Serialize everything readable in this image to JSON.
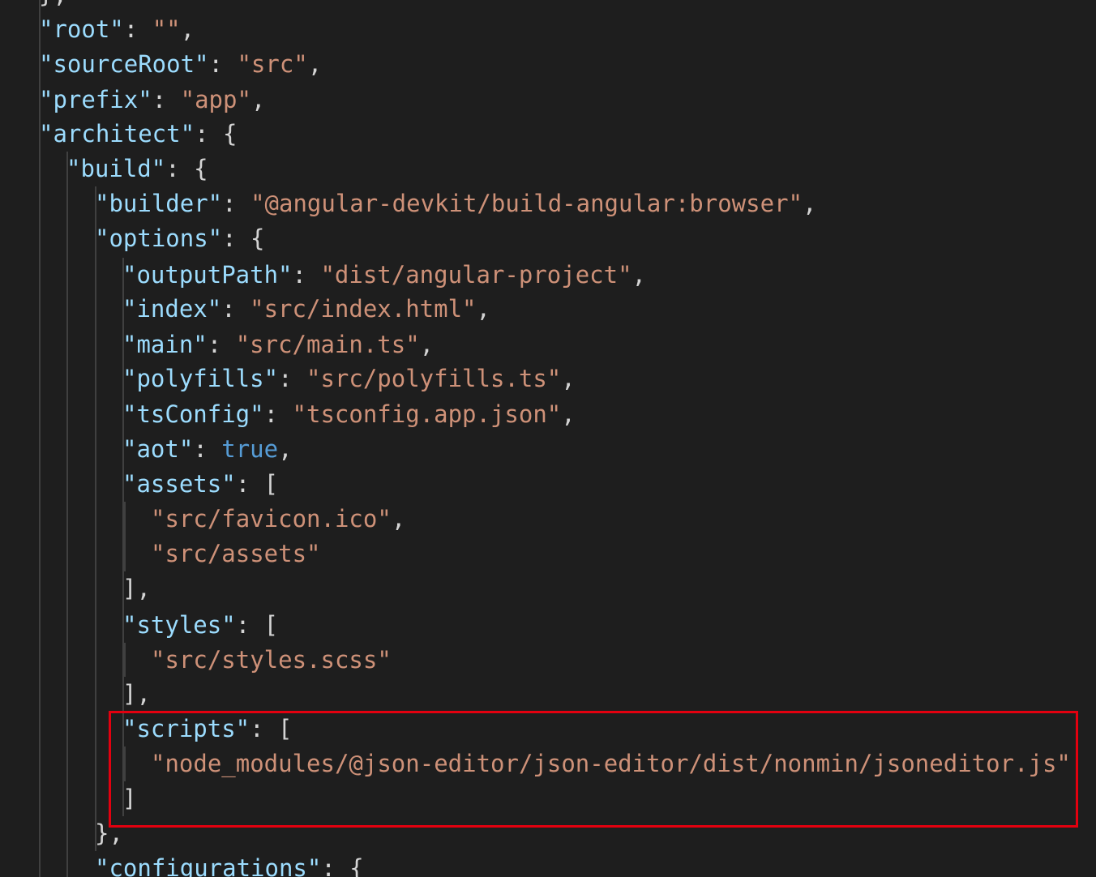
{
  "theme": {
    "background": "#1e1e1e",
    "key_color": "#9cdcfe",
    "string_color": "#ce9178",
    "keyword_color": "#569cd6",
    "punctuation_color": "#d4d4d4",
    "highlight_color": "#e3000f"
  },
  "lines": [
    {
      "tokens": [
        {
          "t": "punc",
          "v": "},"
        }
      ]
    },
    {
      "tokens": [
        {
          "t": "key",
          "v": "\"root\""
        },
        {
          "t": "punc",
          "v": ": "
        },
        {
          "t": "str",
          "v": "\"\""
        },
        {
          "t": "punc",
          "v": ","
        }
      ]
    },
    {
      "tokens": [
        {
          "t": "key",
          "v": "\"sourceRoot\""
        },
        {
          "t": "punc",
          "v": ": "
        },
        {
          "t": "str",
          "v": "\"src\""
        },
        {
          "t": "punc",
          "v": ","
        }
      ]
    },
    {
      "tokens": [
        {
          "t": "key",
          "v": "\"prefix\""
        },
        {
          "t": "punc",
          "v": ": "
        },
        {
          "t": "str",
          "v": "\"app\""
        },
        {
          "t": "punc",
          "v": ","
        }
      ]
    },
    {
      "tokens": [
        {
          "t": "key",
          "v": "\"architect\""
        },
        {
          "t": "punc",
          "v": ": {"
        }
      ]
    },
    {
      "tokens": [
        {
          "t": "key",
          "v": "\"build\""
        },
        {
          "t": "punc",
          "v": ": {"
        }
      ]
    },
    {
      "tokens": [
        {
          "t": "key",
          "v": "\"builder\""
        },
        {
          "t": "punc",
          "v": ": "
        },
        {
          "t": "str",
          "v": "\"@angular-devkit/build-angular:browser\""
        },
        {
          "t": "punc",
          "v": ","
        }
      ]
    },
    {
      "tokens": [
        {
          "t": "key",
          "v": "\"options\""
        },
        {
          "t": "punc",
          "v": ": {"
        }
      ]
    },
    {
      "tokens": [
        {
          "t": "key",
          "v": "\"outputPath\""
        },
        {
          "t": "punc",
          "v": ": "
        },
        {
          "t": "str",
          "v": "\"dist/angular-project\""
        },
        {
          "t": "punc",
          "v": ","
        }
      ]
    },
    {
      "tokens": [
        {
          "t": "key",
          "v": "\"index\""
        },
        {
          "t": "punc",
          "v": ": "
        },
        {
          "t": "str",
          "v": "\"src/index.html\""
        },
        {
          "t": "punc",
          "v": ","
        }
      ]
    },
    {
      "tokens": [
        {
          "t": "key",
          "v": "\"main\""
        },
        {
          "t": "punc",
          "v": ": "
        },
        {
          "t": "str",
          "v": "\"src/main.ts\""
        },
        {
          "t": "punc",
          "v": ","
        }
      ]
    },
    {
      "tokens": [
        {
          "t": "key",
          "v": "\"polyfills\""
        },
        {
          "t": "punc",
          "v": ": "
        },
        {
          "t": "str",
          "v": "\"src/polyfills.ts\""
        },
        {
          "t": "punc",
          "v": ","
        }
      ]
    },
    {
      "tokens": [
        {
          "t": "key",
          "v": "\"tsConfig\""
        },
        {
          "t": "punc",
          "v": ": "
        },
        {
          "t": "str",
          "v": "\"tsconfig.app.json\""
        },
        {
          "t": "punc",
          "v": ","
        }
      ]
    },
    {
      "tokens": [
        {
          "t": "key",
          "v": "\"aot\""
        },
        {
          "t": "punc",
          "v": ": "
        },
        {
          "t": "kw",
          "v": "true"
        },
        {
          "t": "punc",
          "v": ","
        }
      ]
    },
    {
      "tokens": [
        {
          "t": "key",
          "v": "\"assets\""
        },
        {
          "t": "punc",
          "v": ": ["
        }
      ]
    },
    {
      "tokens": [
        {
          "t": "str",
          "v": "\"src/favicon.ico\""
        },
        {
          "t": "punc",
          "v": ","
        }
      ]
    },
    {
      "tokens": [
        {
          "t": "str",
          "v": "\"src/assets\""
        }
      ]
    },
    {
      "tokens": [
        {
          "t": "punc",
          "v": "],"
        }
      ]
    },
    {
      "tokens": [
        {
          "t": "key",
          "v": "\"styles\""
        },
        {
          "t": "punc",
          "v": ": ["
        }
      ]
    },
    {
      "tokens": [
        {
          "t": "str",
          "v": "\"src/styles.scss\""
        }
      ]
    },
    {
      "tokens": [
        {
          "t": "punc",
          "v": "],"
        }
      ]
    },
    {
      "tokens": [
        {
          "t": "key",
          "v": "\"scripts\""
        },
        {
          "t": "punc",
          "v": ": ["
        }
      ]
    },
    {
      "tokens": [
        {
          "t": "str",
          "v": "\"node_modules/@json-editor/json-editor/dist/nonmin/jsoneditor.js\""
        }
      ]
    },
    {
      "tokens": [
        {
          "t": "punc",
          "v": "]"
        }
      ]
    },
    {
      "tokens": [
        {
          "t": "punc",
          "v": "},"
        }
      ]
    },
    {
      "tokens": [
        {
          "t": "key",
          "v": "\"configurations\""
        },
        {
          "t": "punc",
          "v": ": {"
        }
      ]
    }
  ]
}
